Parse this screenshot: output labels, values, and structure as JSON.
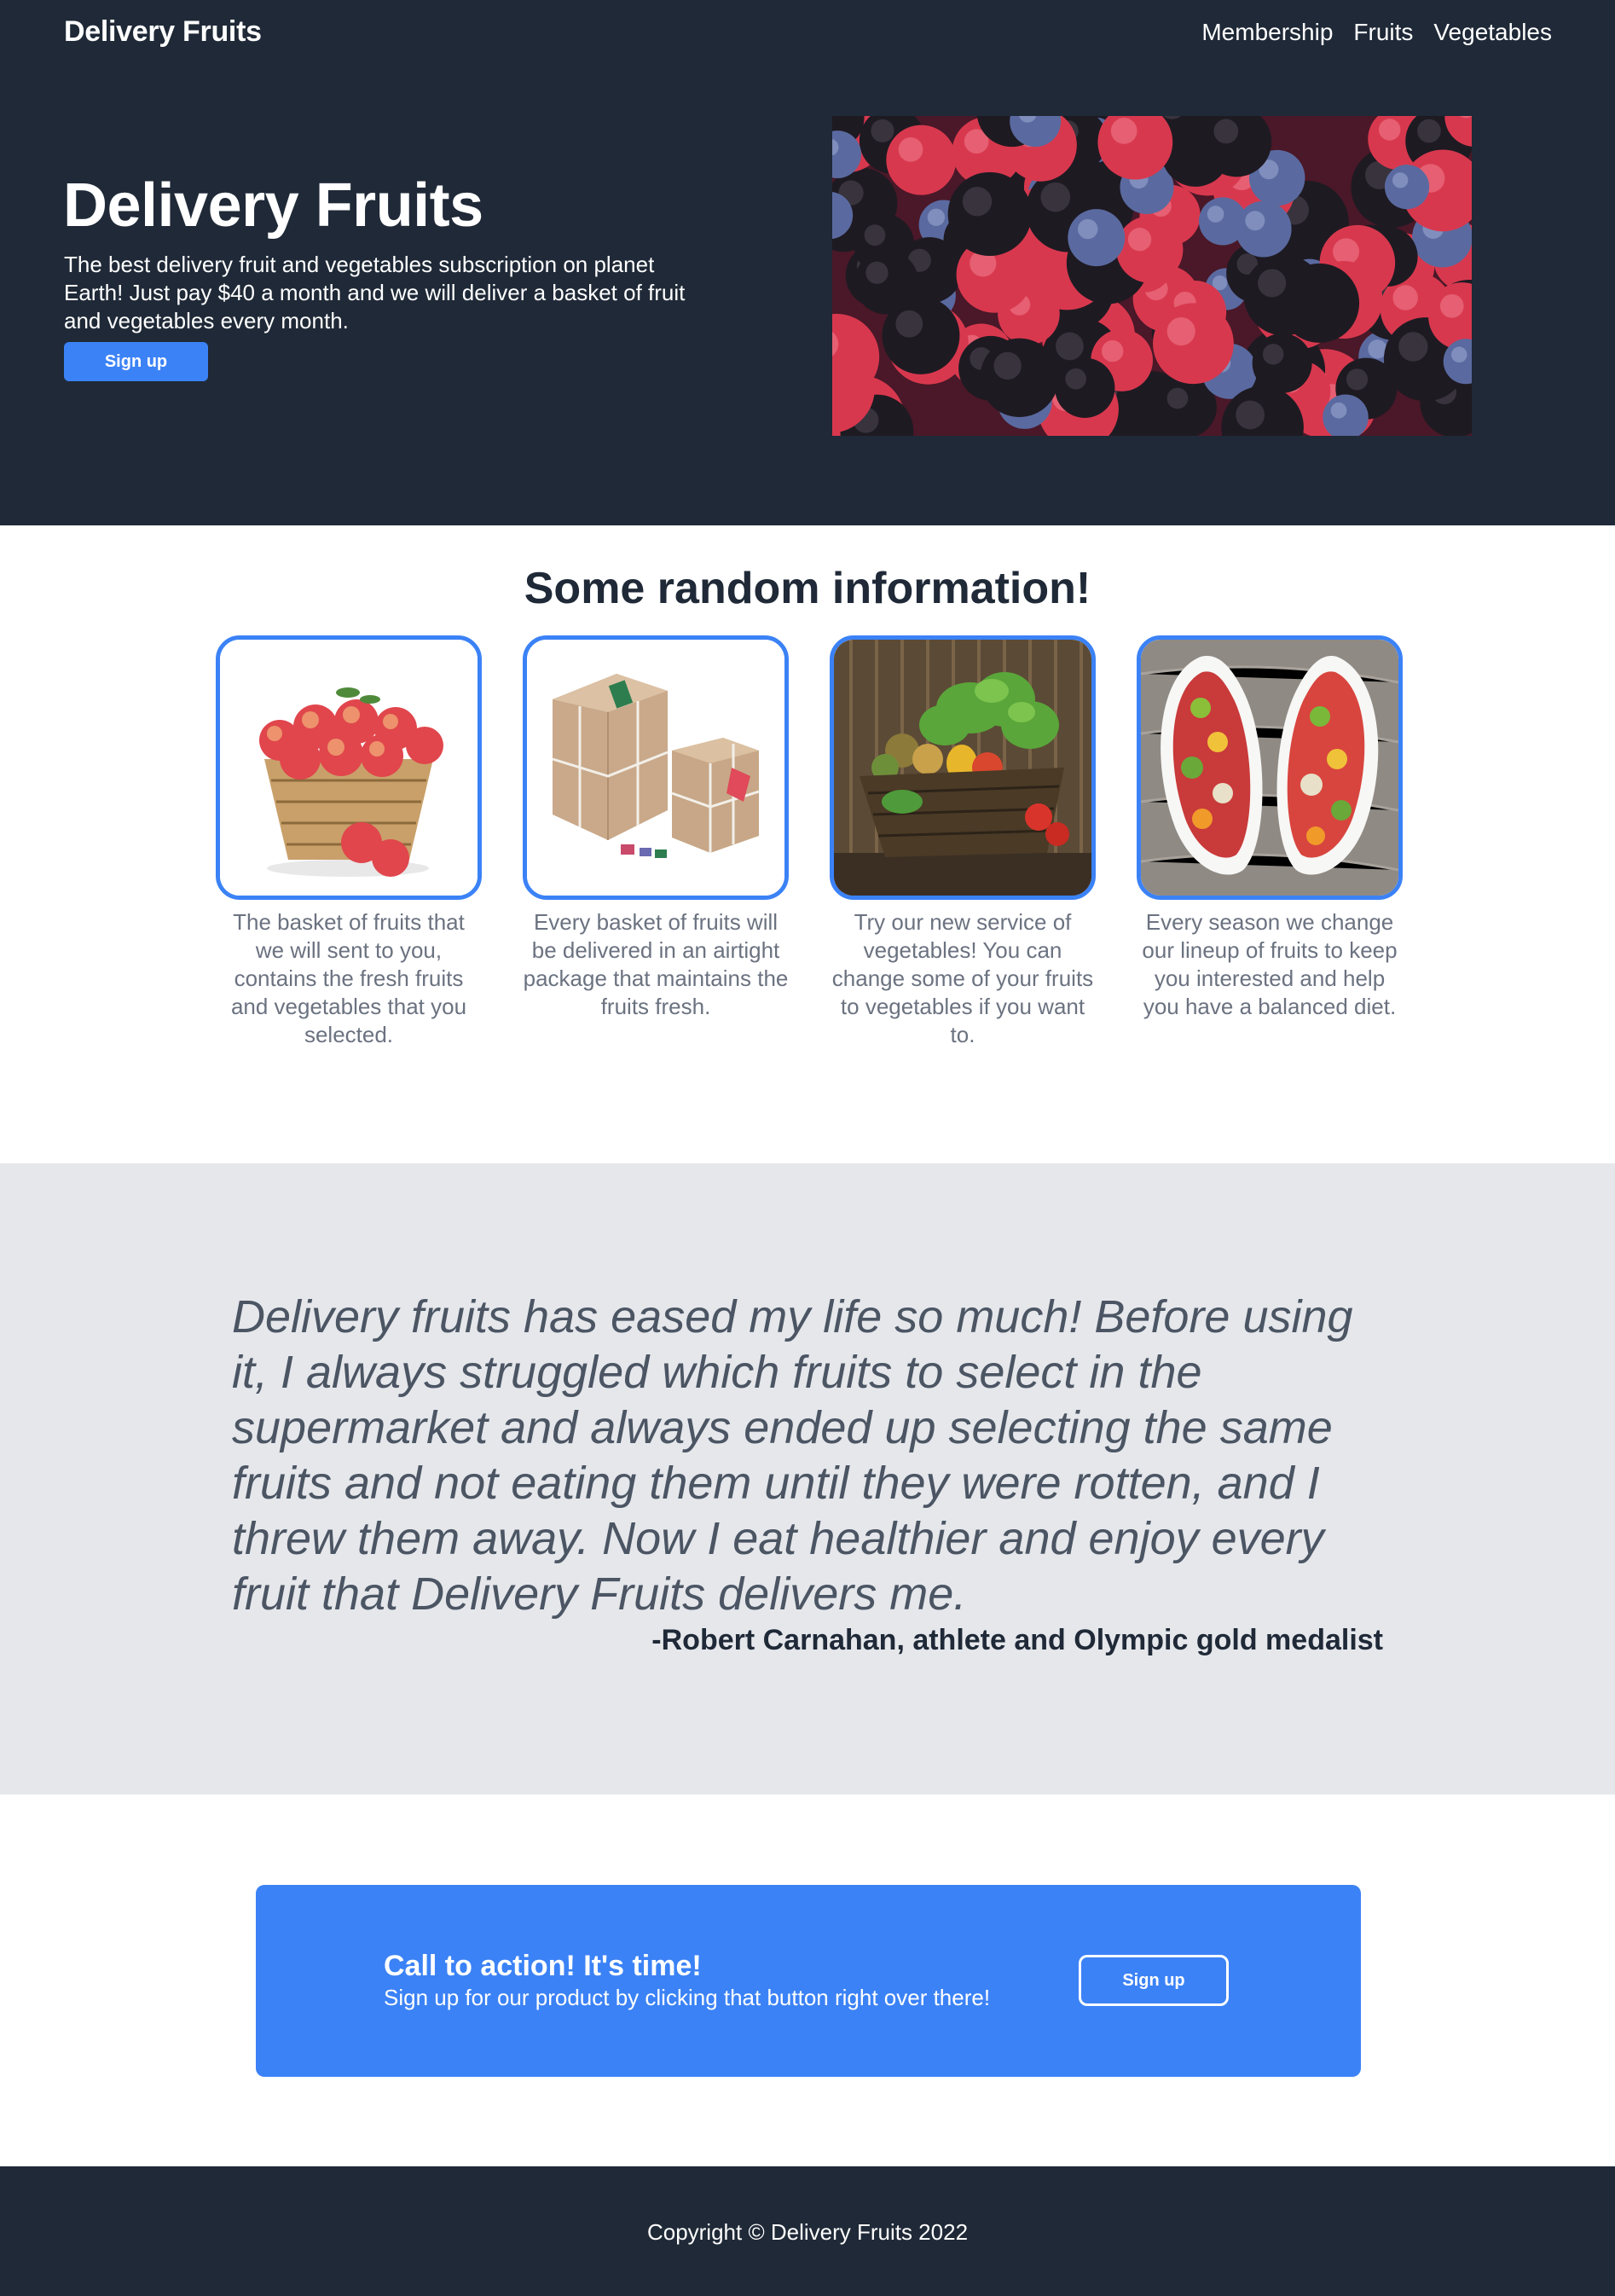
{
  "header": {
    "brand": "Delivery Fruits",
    "nav": [
      "Membership",
      "Fruits",
      "Vegetables"
    ]
  },
  "hero": {
    "title": "Delivery Fruits",
    "description": "The best delivery fruit and vegetables subscription on planet Earth! Just pay $40 a month and we will deliver a basket of fruit and vegetables every month.",
    "button_label": "Sign up",
    "image": "mixed-berries-photo"
  },
  "info": {
    "title": "Some random information!",
    "cards": [
      {
        "image": "apple-basket-photo",
        "text": "The basket of fruits that we will sent to you, contains the fresh fruits and vegetables that you selected."
      },
      {
        "image": "wrapped-packages-photo",
        "text": "Every basket of fruits will be delivered in an airtight package that maintains the fruits fresh."
      },
      {
        "image": "vegetable-basket-photo",
        "text": "Try our new service of vegetables! You can change some of your fruits to vegetables if you want to."
      },
      {
        "image": "fruit-salad-bowls-photo",
        "text": "Every season we change our lineup of fruits to keep you interested and help you have a balanced diet."
      }
    ]
  },
  "testimonial": {
    "quote": "Delivery fruits has eased my life so much! Before using it, I always struggled which fruits to select in the supermarket and always ended up selecting the same fruits and not eating them until they were rotten, and I threw them away. Now I eat healthier and enjoy every fruit that Delivery Fruits delivers me.",
    "author": "-Robert Carnahan, athlete and Olympic gold medalist"
  },
  "cta": {
    "title": "Call to action! It's time!",
    "text": "Sign up for our product by clicking that button right over there!",
    "button_label": "Sign up"
  },
  "footer": {
    "copyright": "Copyright © Delivery Fruits 2022"
  },
  "colors": {
    "dark": "#1f2937",
    "accent": "#3b82f6",
    "muted_text": "#6b7280",
    "testimonial_bg": "#e5e7eb"
  }
}
